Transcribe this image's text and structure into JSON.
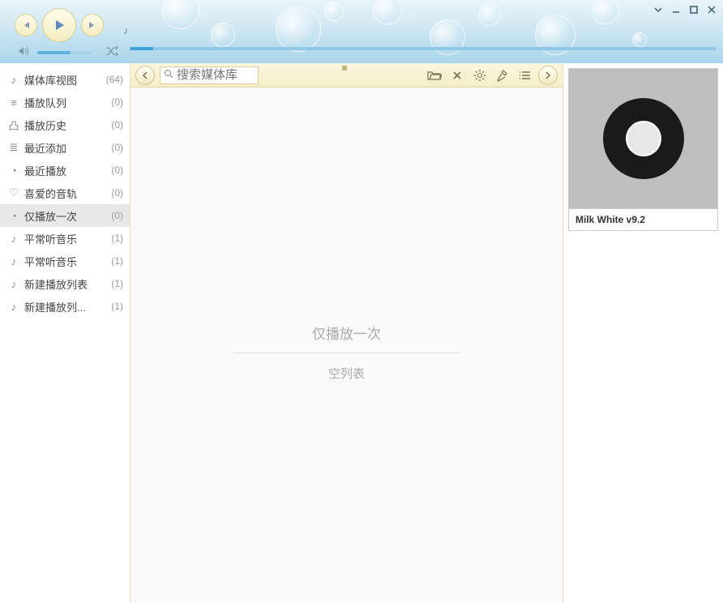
{
  "sidebar": {
    "items": [
      {
        "icon": "library",
        "label": "媒体库视图",
        "count": "(64)"
      },
      {
        "icon": "queue",
        "label": "播放队列",
        "count": "(0)"
      },
      {
        "icon": "history",
        "label": "播放历史",
        "count": "(0)"
      },
      {
        "icon": "recent-add",
        "label": "最近添加",
        "count": "(0)"
      },
      {
        "icon": "recent-play",
        "label": "最近播放",
        "count": "(0)"
      },
      {
        "icon": "favorite",
        "label": "喜爱的音轨",
        "count": "(0)"
      },
      {
        "icon": "play-once",
        "label": "仅播放一次",
        "count": "(0)",
        "selected": true
      },
      {
        "icon": "playlist",
        "label": "平常听音乐",
        "count": "(1)"
      },
      {
        "icon": "playlist",
        "label": "平常听音乐",
        "count": "(1)"
      },
      {
        "icon": "playlist",
        "label": "新建播放列表",
        "count": "(1)"
      },
      {
        "icon": "playlist",
        "label": "新建播放列...",
        "count": "(1)"
      }
    ]
  },
  "toolbar": {
    "search_placeholder": "搜索媒体库"
  },
  "content": {
    "title": "仅播放一次",
    "empty": "空列表"
  },
  "right_panel": {
    "album_label": "Milk White v9.2"
  }
}
